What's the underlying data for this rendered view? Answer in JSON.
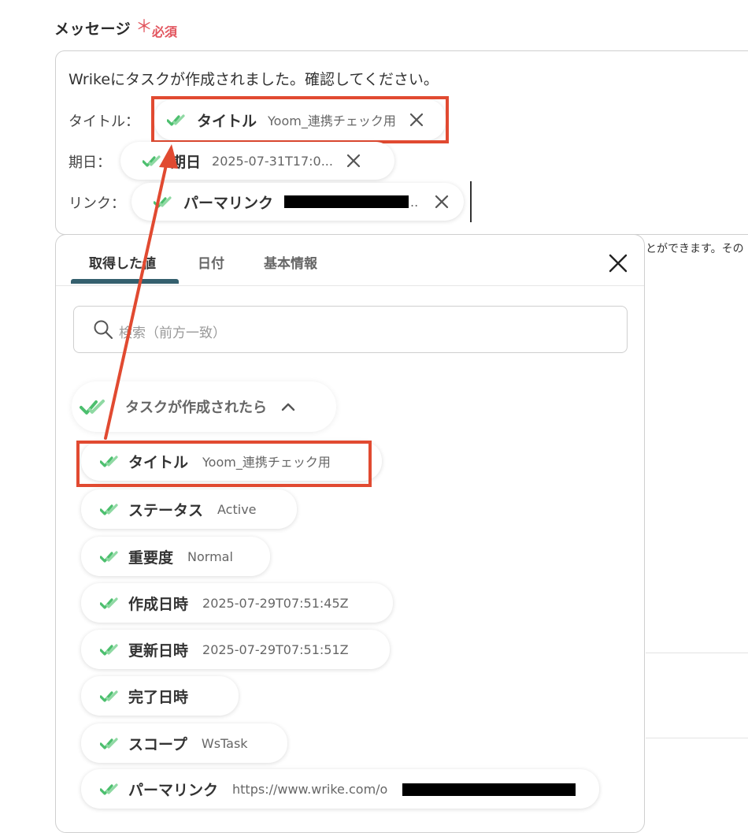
{
  "field": {
    "label": "メッセージ",
    "required_star": "＊",
    "required_text": "必須"
  },
  "message": {
    "line1": "Wrikeにタスクが作成されました。確認してください。",
    "rows": [
      {
        "label": "タイトル：",
        "pill_name": "タイトル",
        "pill_value": "Yoom_連携チェック用"
      },
      {
        "label": "期日：",
        "pill_name": "期日",
        "pill_value": "2025-07-31T17:0..."
      },
      {
        "label": "リンク：",
        "pill_name": "パーマリンク",
        "pill_value": ".."
      }
    ]
  },
  "helper_text": "とができます。その",
  "panel": {
    "tabs": [
      "取得した値",
      "日付",
      "基本情報"
    ],
    "active_tab": 0,
    "search_placeholder": "検索（前方一致）",
    "group_title": "タスクが作成されたら",
    "items": [
      {
        "name": "タイトル",
        "value": "Yoom_連携チェック用"
      },
      {
        "name": "ステータス",
        "value": "Active"
      },
      {
        "name": "重要度",
        "value": "Normal"
      },
      {
        "name": "作成日時",
        "value": "2025-07-29T07:51:45Z"
      },
      {
        "name": "更新日時",
        "value": "2025-07-29T07:51:51Z"
      },
      {
        "name": "完了日時",
        "value": ""
      },
      {
        "name": "スコープ",
        "value": "WsTask"
      },
      {
        "name": "パーマリンク",
        "value": "https://www.wrike.com/o"
      }
    ]
  },
  "colors": {
    "accent": "#35606e",
    "check": "#4cbf6e",
    "highlight": "#e14a31",
    "required": "#e2555e"
  }
}
